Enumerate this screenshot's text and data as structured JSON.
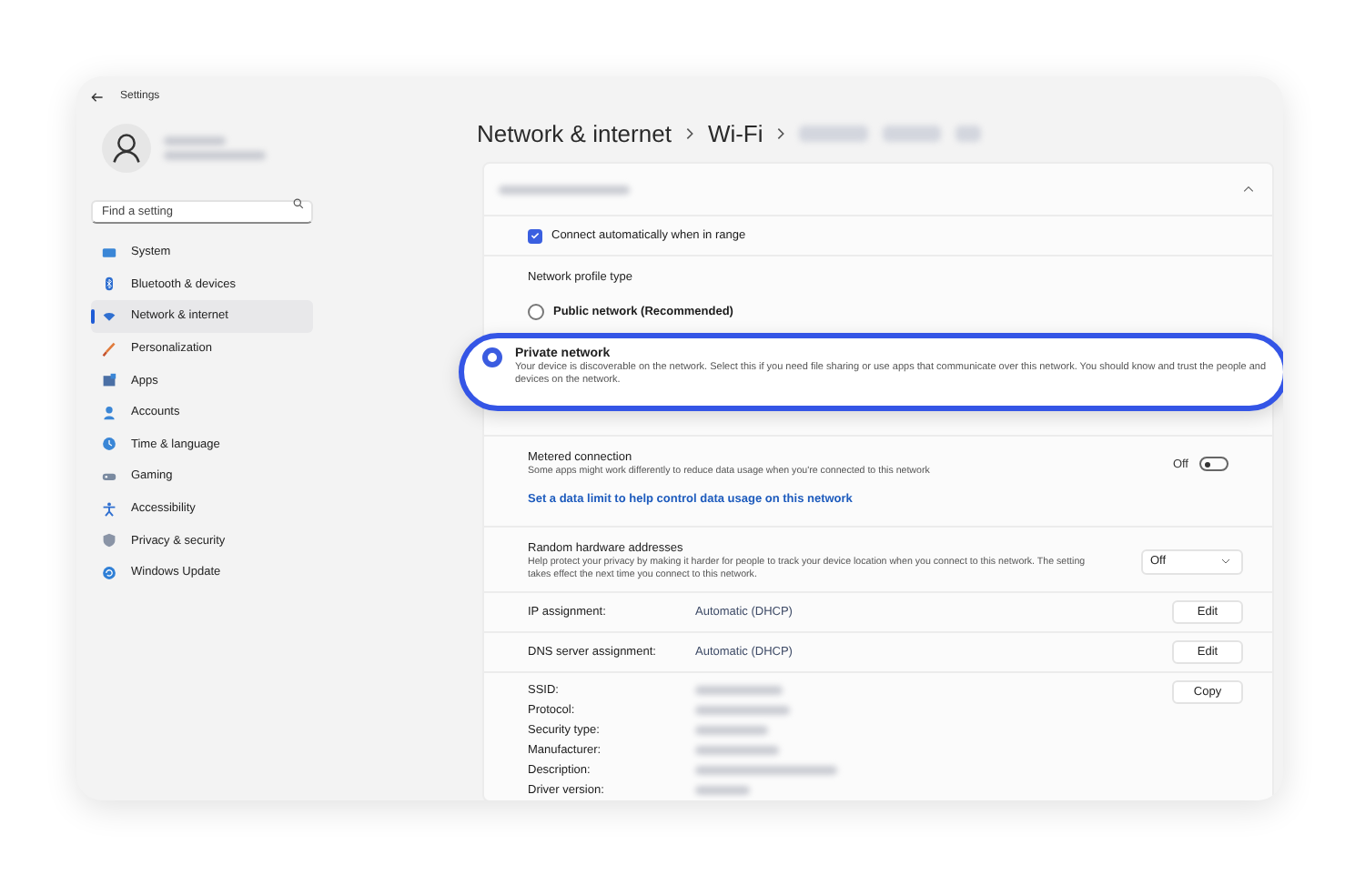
{
  "window": {
    "title": "Settings"
  },
  "sidebar": {
    "search": {
      "placeholder": "Find a setting"
    },
    "items": [
      {
        "label": "System",
        "selected": false
      },
      {
        "label": "Bluetooth & devices",
        "selected": false
      },
      {
        "label": "Network & internet",
        "selected": true
      },
      {
        "label": "Personalization",
        "selected": false
      },
      {
        "label": "Apps",
        "selected": false
      },
      {
        "label": "Accounts",
        "selected": false
      },
      {
        "label": "Time & language",
        "selected": false
      },
      {
        "label": "Gaming",
        "selected": false
      },
      {
        "label": "Accessibility",
        "selected": false
      },
      {
        "label": "Privacy & security",
        "selected": false
      },
      {
        "label": "Windows Update",
        "selected": false
      }
    ]
  },
  "breadcrumb": [
    "Network & internet",
    "Wi-Fi"
  ],
  "connect_automatically": {
    "label": "Connect automatically when in range",
    "checked": true
  },
  "network_profile": {
    "title": "Network profile type",
    "options": [
      {
        "label": "Public network (Recommended)",
        "selected": false
      }
    ]
  },
  "callout": {
    "label": "Private network",
    "description": "Your device is discoverable on the network. Select this if you need file sharing or use apps that communicate over this network. You should know and trust the people and devices on the network.",
    "selected": true
  },
  "metered_connection": {
    "title": "Metered connection",
    "description": "Some apps might work differently to reduce data usage when you're connected to this network",
    "toggle_label": "Off",
    "on": false
  },
  "data_limit_link": "Set a data limit to help control data usage on this network",
  "random_hardware_addresses": {
    "title": "Random hardware addresses",
    "description": "Help protect your privacy by making it harder for people to track your device location when you connect to this network. The setting takes effect the next time you connect to this network.",
    "value": "Off"
  },
  "assignments": [
    {
      "label": "IP assignment:",
      "value": "Automatic (DHCP)",
      "button": "Edit"
    },
    {
      "label": "DNS server assignment:",
      "value": "Automatic (DHCP)",
      "button": "Edit"
    }
  ],
  "properties": {
    "labels": [
      "SSID:",
      "Protocol:",
      "Security type:",
      "Manufacturer:",
      "Description:",
      "Driver version:"
    ],
    "button": "Copy"
  }
}
